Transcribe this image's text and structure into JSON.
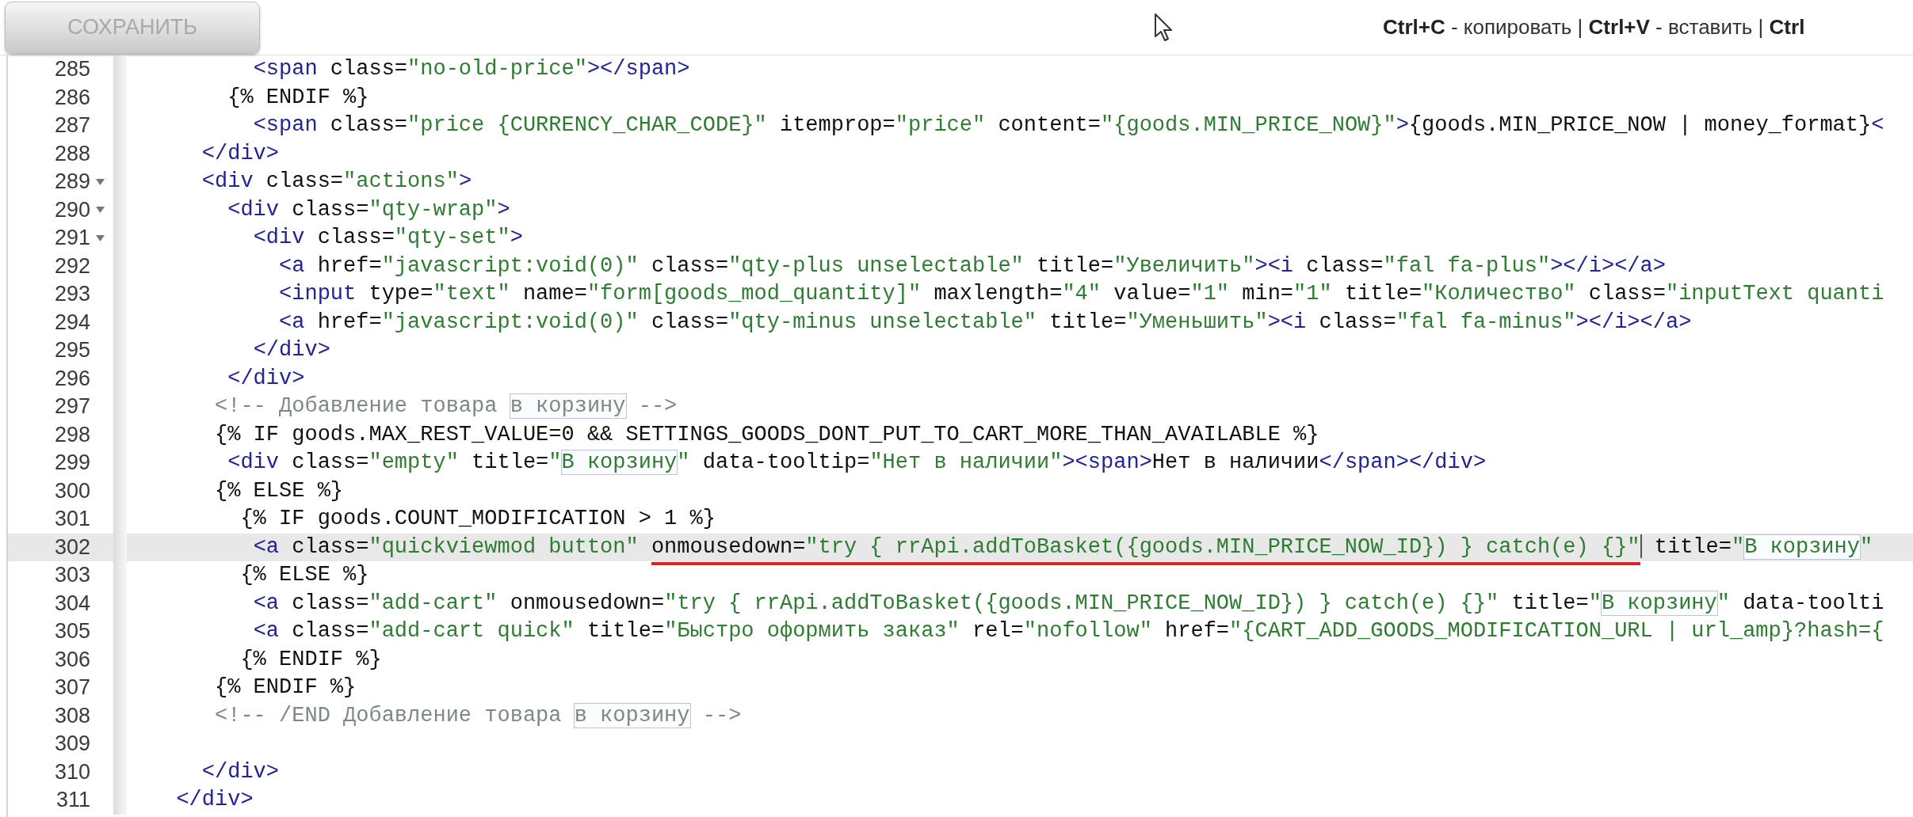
{
  "toolbar": {
    "save_button": {
      "label": "СОХРАНИТЬ",
      "disabled": true
    },
    "hint": "**Ctrl+C** - копировать | **Ctrl+V** - вставить | **Ctrl**"
  },
  "editor": {
    "lines": [
      {
        "number": "285",
        "active": false,
        "tokens": [
          {
            "kind": "tag",
            "text": "        <span"
          },
          {
            "kind": "attr",
            "text": " class="
          },
          {
            "kind": "str",
            "text": "\"no-old-price\""
          },
          {
            "kind": "tag",
            "text": "></span>"
          }
        ]
      },
      {
        "number": "286",
        "active": false,
        "tokens": [
          {
            "kind": "text",
            "text": "      {% ENDIF %}"
          }
        ]
      },
      {
        "number": "287",
        "active": false,
        "tokens": [
          {
            "kind": "tag",
            "text": "        <span"
          },
          {
            "kind": "attr",
            "text": " class="
          },
          {
            "kind": "str",
            "text": "\"price {CURRENCY_CHAR_CODE}\""
          },
          {
            "kind": "attr",
            "text": " itemprop="
          },
          {
            "kind": "str",
            "text": "\"price\""
          },
          {
            "kind": "attr",
            "text": " content="
          },
          {
            "kind": "str",
            "text": "\"{goods.MIN_PRICE_NOW}\""
          },
          {
            "kind": "tag",
            "text": ">"
          },
          {
            "kind": "text",
            "text": "{goods.MIN_PRICE_NOW | money_format}"
          },
          {
            "kind": "tag",
            "text": "<"
          }
        ]
      },
      {
        "number": "288",
        "active": false,
        "tokens": [
          {
            "kind": "tag",
            "text": "    </div>"
          }
        ]
      },
      {
        "number": "289",
        "active": false,
        "expanded": true,
        "tokens": [
          {
            "kind": "tag",
            "text": "    <div"
          },
          {
            "kind": "attr",
            "text": " class="
          },
          {
            "kind": "str",
            "text": "\"actions\""
          },
          {
            "kind": "tag",
            "text": ">"
          }
        ]
      },
      {
        "number": "290",
        "active": false,
        "expanded": true,
        "tokens": [
          {
            "kind": "tag",
            "text": "      <div"
          },
          {
            "kind": "attr",
            "text": " class="
          },
          {
            "kind": "str",
            "text": "\"qty-wrap\""
          },
          {
            "kind": "tag",
            "text": ">"
          }
        ]
      },
      {
        "number": "291",
        "active": false,
        "expanded": true,
        "tokens": [
          {
            "kind": "tag",
            "text": "        <div"
          },
          {
            "kind": "attr",
            "text": " class="
          },
          {
            "kind": "str",
            "text": "\"qty-set\""
          },
          {
            "kind": "tag",
            "text": ">"
          }
        ]
      },
      {
        "number": "292",
        "active": false,
        "tokens": [
          {
            "kind": "tag",
            "text": "          <a"
          },
          {
            "kind": "attr",
            "text": " href="
          },
          {
            "kind": "str",
            "text": "\"javascript:void(0)\""
          },
          {
            "kind": "attr",
            "text": " class="
          },
          {
            "kind": "str",
            "text": "\"qty-plus unselectable\""
          },
          {
            "kind": "attr",
            "text": " title="
          },
          {
            "kind": "str",
            "text": "\"Увеличить\""
          },
          {
            "kind": "tag",
            "text": "><i"
          },
          {
            "kind": "attr",
            "text": " class="
          },
          {
            "kind": "str",
            "text": "\"fal fa-plus\""
          },
          {
            "kind": "tag",
            "text": "></i></a>"
          }
        ]
      },
      {
        "number": "293",
        "active": false,
        "tokens": [
          {
            "kind": "tag",
            "text": "          <input"
          },
          {
            "kind": "attr",
            "text": " type="
          },
          {
            "kind": "str",
            "text": "\"text\""
          },
          {
            "kind": "attr",
            "text": " name="
          },
          {
            "kind": "str",
            "text": "\"form[goods_mod_quantity]\""
          },
          {
            "kind": "attr",
            "text": " maxlength="
          },
          {
            "kind": "str",
            "text": "\"4\""
          },
          {
            "kind": "attr",
            "text": " value="
          },
          {
            "kind": "str",
            "text": "\"1\""
          },
          {
            "kind": "attr",
            "text": " min="
          },
          {
            "kind": "str",
            "text": "\"1\""
          },
          {
            "kind": "attr",
            "text": " title="
          },
          {
            "kind": "str",
            "text": "\"Количество\""
          },
          {
            "kind": "attr",
            "text": " class="
          },
          {
            "kind": "str",
            "text": "\"inputText quanti"
          }
        ]
      },
      {
        "number": "294",
        "active": false,
        "tokens": [
          {
            "kind": "tag",
            "text": "          <a"
          },
          {
            "kind": "attr",
            "text": " href="
          },
          {
            "kind": "str",
            "text": "\"javascript:void(0)\""
          },
          {
            "kind": "attr",
            "text": " class="
          },
          {
            "kind": "str",
            "text": "\"qty-minus unselectable\""
          },
          {
            "kind": "attr",
            "text": " title="
          },
          {
            "kind": "str",
            "text": "\"Уменьшить\""
          },
          {
            "kind": "tag",
            "text": "><i"
          },
          {
            "kind": "attr",
            "text": " class="
          },
          {
            "kind": "str",
            "text": "\"fal fa-minus\""
          },
          {
            "kind": "tag",
            "text": "></i></a>"
          }
        ]
      },
      {
        "number": "295",
        "active": false,
        "tokens": [
          {
            "kind": "tag",
            "text": "        </div>"
          }
        ]
      },
      {
        "number": "296",
        "active": false,
        "tokens": [
          {
            "kind": "tag",
            "text": "      </div>"
          }
        ]
      },
      {
        "number": "297",
        "active": false,
        "tokens": [
          {
            "kind": "comment",
            "text": "     <!-- Добавление товара "
          },
          {
            "kind": "comment-match",
            "text": "в корзину"
          },
          {
            "kind": "comment",
            "text": " -->"
          }
        ]
      },
      {
        "number": "298",
        "active": false,
        "tokens": [
          {
            "kind": "text",
            "text": "     {% IF goods.MAX_REST_VALUE=0 && SETTINGS_GOODS_DONT_PUT_TO_CART_MORE_THAN_AVAILABLE %}"
          }
        ]
      },
      {
        "number": "299",
        "active": false,
        "tokens": [
          {
            "kind": "tag",
            "text": "      <div"
          },
          {
            "kind": "attr",
            "text": " class="
          },
          {
            "kind": "str",
            "text": "\"empty\""
          },
          {
            "kind": "attr",
            "text": " title="
          },
          {
            "kind": "str",
            "text": "\""
          },
          {
            "kind": "str-match",
            "text": "В корзину"
          },
          {
            "kind": "str",
            "text": "\""
          },
          {
            "kind": "attr",
            "text": " data-tooltip="
          },
          {
            "kind": "str",
            "text": "\"Нет в наличии\""
          },
          {
            "kind": "tag",
            "text": "><span>"
          },
          {
            "kind": "text",
            "text": "Нет в наличии"
          },
          {
            "kind": "tag",
            "text": "</span></div>"
          }
        ]
      },
      {
        "number": "300",
        "active": false,
        "tokens": [
          {
            "kind": "text",
            "text": "     {% ELSE %}"
          }
        ]
      },
      {
        "number": "301",
        "active": false,
        "tokens": [
          {
            "kind": "text",
            "text": "       {% IF goods.COUNT_MODIFICATION > 1 %}"
          }
        ]
      },
      {
        "number": "302",
        "active": true,
        "tokens": [
          {
            "kind": "tag",
            "text": "        <a"
          },
          {
            "kind": "attr",
            "text": " class="
          },
          {
            "kind": "str",
            "text": "\"quickviewmod button\" "
          },
          {
            "kind": "underline",
            "tokens": [
              {
                "kind": "attr",
                "text": "onmousedown="
              },
              {
                "kind": "str",
                "text": "\"try { rrApi.addToBasket({goods.MIN_PRICE_NOW_ID}) } catch(e) {}\""
              }
            ]
          },
          {
            "kind": "caret"
          },
          {
            "kind": "attr",
            "text": " title="
          },
          {
            "kind": "str",
            "text": "\""
          },
          {
            "kind": "str-match",
            "text": "В корзину"
          },
          {
            "kind": "str",
            "text": "\""
          }
        ]
      },
      {
        "number": "303",
        "active": false,
        "tokens": [
          {
            "kind": "text",
            "text": "       {% ELSE %}"
          }
        ]
      },
      {
        "number": "304",
        "active": false,
        "tokens": [
          {
            "kind": "tag",
            "text": "        <a"
          },
          {
            "kind": "attr",
            "text": " class="
          },
          {
            "kind": "str",
            "text": "\"add-cart\""
          },
          {
            "kind": "attr",
            "text": " onmousedown="
          },
          {
            "kind": "str",
            "text": "\"try { rrApi.addToBasket({goods.MIN_PRICE_NOW_ID}) } catch(e) {}\""
          },
          {
            "kind": "attr",
            "text": " title="
          },
          {
            "kind": "str",
            "text": "\""
          },
          {
            "kind": "str-match",
            "text": "В корзину"
          },
          {
            "kind": "str",
            "text": "\""
          },
          {
            "kind": "attr",
            "text": " data-toolti"
          }
        ]
      },
      {
        "number": "305",
        "active": false,
        "tokens": [
          {
            "kind": "tag",
            "text": "        <a"
          },
          {
            "kind": "attr",
            "text": " class="
          },
          {
            "kind": "str",
            "text": "\"add-cart quick\""
          },
          {
            "kind": "attr",
            "text": " title="
          },
          {
            "kind": "str",
            "text": "\"Быстро оформить заказ\""
          },
          {
            "kind": "attr",
            "text": " rel="
          },
          {
            "kind": "str",
            "text": "\"nofollow\""
          },
          {
            "kind": "attr",
            "text": " href="
          },
          {
            "kind": "str",
            "text": "\"{CART_ADD_GOODS_MODIFICATION_URL | url_amp}?hash={"
          }
        ]
      },
      {
        "number": "306",
        "active": false,
        "tokens": [
          {
            "kind": "text",
            "text": "       {% ENDIF %}"
          }
        ]
      },
      {
        "number": "307",
        "active": false,
        "tokens": [
          {
            "kind": "text",
            "text": "     {% ENDIF %}"
          }
        ]
      },
      {
        "number": "308",
        "active": false,
        "tokens": [
          {
            "kind": "comment",
            "text": "     <!-- /END Добавление товара "
          },
          {
            "kind": "comment-match",
            "text": "в корзину"
          },
          {
            "kind": "comment",
            "text": " -->"
          }
        ]
      },
      {
        "number": "309",
        "active": false
      },
      {
        "number": "310",
        "active": false,
        "tokens": [
          {
            "kind": "tag",
            "text": "    </div>"
          }
        ]
      },
      {
        "number": "311",
        "active": false,
        "tokens": [
          {
            "kind": "tag",
            "text": "  </div>"
          }
        ]
      }
    ]
  }
}
